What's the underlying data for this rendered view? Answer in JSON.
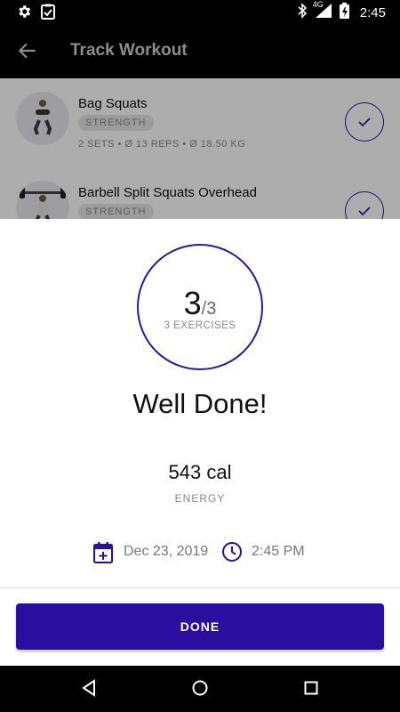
{
  "status_bar": {
    "time": "2:45",
    "network": "4G",
    "icons": [
      "settings-icon",
      "clipboard-check-icon",
      "bluetooth-icon",
      "signal-icon",
      "battery-icon"
    ]
  },
  "app_bar": {
    "title": "Track Workout"
  },
  "exercises": [
    {
      "name": "Bag Squats",
      "tag": "STRENGTH",
      "meta": "2 SETS  •  Ø 13 REPS  •  Ø 18.50 KG",
      "completed": true
    },
    {
      "name": "Barbell Split Squats Overhead",
      "tag": "STRENGTH",
      "meta": "",
      "completed": true
    }
  ],
  "summary": {
    "completed": "3",
    "total": "/3",
    "exercises_label": "3 EXERCISES",
    "headline": "Well Done!",
    "energy_value": "543 cal",
    "energy_label": "ENERGY",
    "date": "Dec 23, 2019",
    "time": "2:45 PM",
    "done_label": "DONE"
  },
  "colors": {
    "accent": "#2a0ea0",
    "ring": "#2a1aa0"
  }
}
